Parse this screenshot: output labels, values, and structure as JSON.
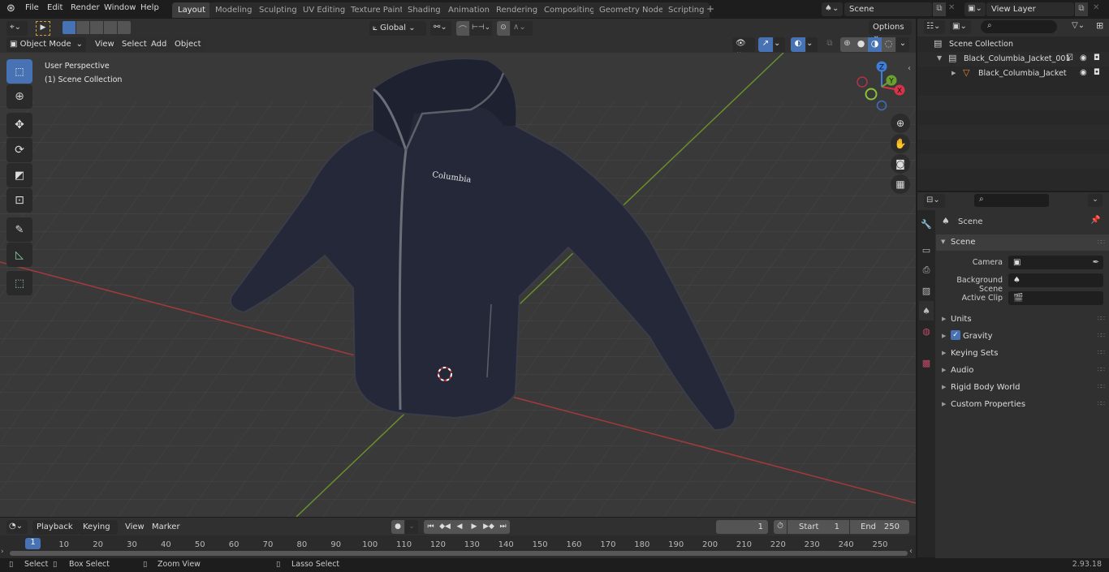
{
  "topbar": {
    "menu": [
      "File",
      "Edit",
      "Render",
      "Window",
      "Help"
    ],
    "workspaces": [
      "Layout",
      "Modeling",
      "Sculpting",
      "UV Editing",
      "Texture Paint",
      "Shading",
      "Animation",
      "Rendering",
      "Compositing",
      "Geometry Nodes",
      "Scripting"
    ],
    "active_workspace": "Layout",
    "add_workspace": "+",
    "scene_name": "Scene",
    "view_layer": "View Layer"
  },
  "viewport_header": {
    "mode": "Object Mode",
    "menus": [
      "View",
      "Select",
      "Add",
      "Object"
    ],
    "orientation": "Global",
    "options_label": "Options"
  },
  "viewport": {
    "view_label": "User Perspective",
    "collection_label": "(1) Scene Collection",
    "logo_text": "Columbia",
    "gizmo": {
      "x": "X",
      "y": "Y",
      "z": "Z"
    }
  },
  "tools": [
    "select-box",
    "cursor",
    "move",
    "rotate",
    "scale",
    "transform",
    "annotate",
    "measure",
    "add-cube"
  ],
  "outliner": {
    "root": "Scene Collection",
    "items": [
      {
        "name": "Black_Columbia_Jacket_001",
        "type": "collection"
      },
      {
        "name": "Black_Columbia_Jacket",
        "type": "mesh"
      }
    ]
  },
  "properties": {
    "context": "Scene",
    "panel": "Scene",
    "fields": [
      {
        "label": "Camera",
        "value": ""
      },
      {
        "label": "Background Scene",
        "value": ""
      },
      {
        "label": "Active Clip",
        "value": ""
      }
    ],
    "sections": [
      "Units",
      "Gravity",
      "Keying Sets",
      "Audio",
      "Rigid Body World",
      "Custom Properties"
    ],
    "gravity_checked": true
  },
  "timeline": {
    "menus": [
      "Playback",
      "Keying",
      "View",
      "Marker"
    ],
    "current_frame": "1",
    "start_label": "Start",
    "start": "1",
    "end_label": "End",
    "end": "250",
    "ticks": [
      "10",
      "20",
      "30",
      "40",
      "50",
      "60",
      "70",
      "80",
      "90",
      "100",
      "110",
      "120",
      "130",
      "140",
      "150",
      "160",
      "170",
      "180",
      "190",
      "200",
      "210",
      "220",
      "230",
      "240",
      "250"
    ],
    "playhead": "1"
  },
  "status": {
    "select": "Select",
    "box_select": "Box Select",
    "zoom_view": "Zoom View",
    "lasso_select": "Lasso Select",
    "version": "2.93.18"
  }
}
